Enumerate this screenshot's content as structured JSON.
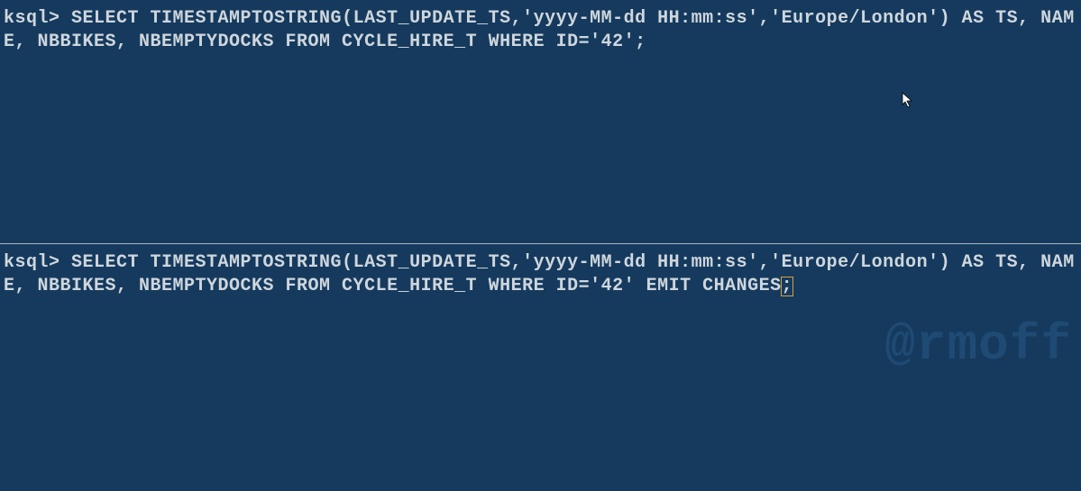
{
  "top_pane": {
    "prompt": "ksql> ",
    "query": "SELECT TIMESTAMPTOSTRING(LAST_UPDATE_TS,'yyyy-MM-dd HH:mm:ss','Europe/London') AS TS, NAME, NBBIKES, NBEMPTYDOCKS FROM CYCLE_HIRE_T WHERE ID='42';"
  },
  "bottom_pane": {
    "prompt": "ksql> ",
    "query_before_cursor": "SELECT TIMESTAMPTOSTRING(LAST_UPDATE_TS,'yyyy-MM-dd HH:mm:ss','Europe/London') AS TS, NAME, NBBIKES, NBEMPTYDOCKS FROM CYCLE_HIRE_T WHERE ID='42' EMIT CHANGES",
    "cursor_char": ";"
  },
  "watermark": "@rmoff"
}
